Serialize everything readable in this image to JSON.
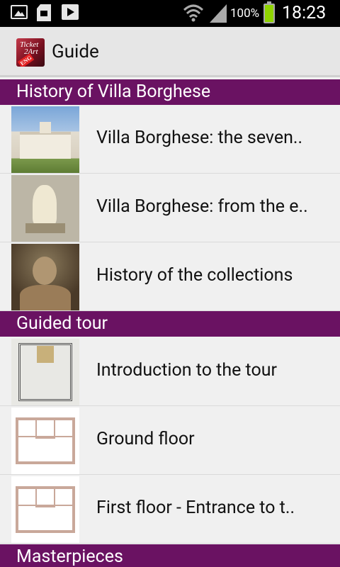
{
  "status_bar": {
    "battery_percent": "100%",
    "time": "18:23",
    "icons": [
      "image-icon",
      "sd-card-icon",
      "play-store-icon",
      "wifi-icon",
      "signal-icon",
      "battery-icon"
    ]
  },
  "action_bar": {
    "logo_lines": [
      "Ticket",
      "2Art",
      "ENG"
    ],
    "title": "Guide"
  },
  "sections": [
    {
      "title": "History of Villa Borghese",
      "items": [
        {
          "label": "Villa Borghese: the seven..",
          "thumb": "villa"
        },
        {
          "label": "Villa Borghese: from the e..",
          "thumb": "sculpture"
        },
        {
          "label": "History of the collections",
          "thumb": "bust"
        }
      ]
    },
    {
      "title": "Guided tour",
      "items": [
        {
          "label": "Introduction to the tour",
          "thumb": "hall"
        },
        {
          "label": "Ground floor",
          "thumb": "floor-plan"
        },
        {
          "label": "First floor - Entrance to t..",
          "thumb": "floor-plan"
        }
      ]
    },
    {
      "title": "Masterpieces",
      "items": []
    }
  ],
  "colors": {
    "section_header": "#6a1262",
    "action_bar": "#e6e6e6",
    "list_background": "#f0f0f0"
  }
}
